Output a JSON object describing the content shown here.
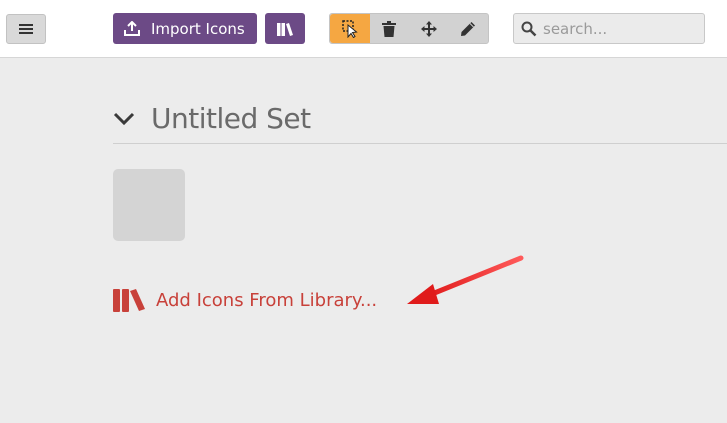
{
  "toolbar": {
    "menu_icon": "hamburger-icon",
    "import_label": "Import Icons",
    "import_icon": "upload-icon",
    "library_icon": "books-icon",
    "tools": [
      {
        "name": "select",
        "icon": "cursor-icon",
        "active": true
      },
      {
        "name": "delete",
        "icon": "trash-icon",
        "active": false
      },
      {
        "name": "move",
        "icon": "move-icon",
        "active": false
      },
      {
        "name": "edit",
        "icon": "pencil-icon",
        "active": false
      }
    ],
    "search_placeholder": "search..."
  },
  "set": {
    "title": "Untitled Set",
    "add_from_library_label": "Add Icons From Library..."
  },
  "colors": {
    "brand_purple": "#6c4a86",
    "active_tool": "#f5a742",
    "accent_red": "#c8413a",
    "annotation_arrow": "#e01b1b"
  }
}
